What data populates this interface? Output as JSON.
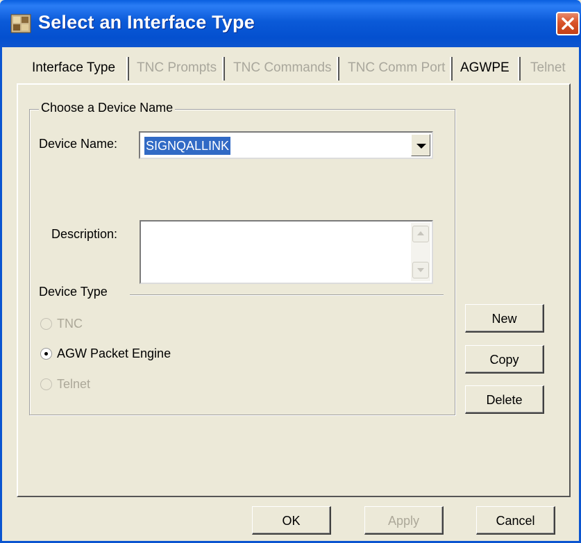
{
  "window": {
    "title": "Select an Interface Type",
    "icon": "app-settings-icon",
    "close_icon": "close-icon"
  },
  "tabs": [
    {
      "label": "Interface Type",
      "active": true,
      "enabled": true
    },
    {
      "label": "TNC Prompts",
      "active": false,
      "enabled": false
    },
    {
      "label": "TNC Commands",
      "active": false,
      "enabled": false
    },
    {
      "label": "TNC Comm Port",
      "active": false,
      "enabled": false
    },
    {
      "label": "AGWPE",
      "active": false,
      "enabled": true
    },
    {
      "label": "Telnet",
      "active": false,
      "enabled": false
    }
  ],
  "device_group": {
    "title": "Choose a Device Name",
    "device_name_label": "Device Name:",
    "device_name_value": "SIGNQALLINK",
    "description_label": "Description:",
    "description_value": "",
    "device_type_label": "Device Type"
  },
  "device_types": [
    {
      "label": "TNC",
      "selected": false,
      "enabled": false
    },
    {
      "label": "AGW Packet Engine",
      "selected": true,
      "enabled": true
    },
    {
      "label": "Telnet",
      "selected": false,
      "enabled": false
    }
  ],
  "side_buttons": {
    "new": "New",
    "copy": "Copy",
    "delete": "Delete"
  },
  "bottom_buttons": {
    "ok": "OK",
    "apply": "Apply",
    "cancel": "Cancel",
    "apply_enabled": false
  },
  "colors": {
    "titlebar": "#0b5ad8",
    "selection": "#316ac5",
    "dialog_bg": "#ece9d8",
    "disabled_text": "#aca899"
  }
}
